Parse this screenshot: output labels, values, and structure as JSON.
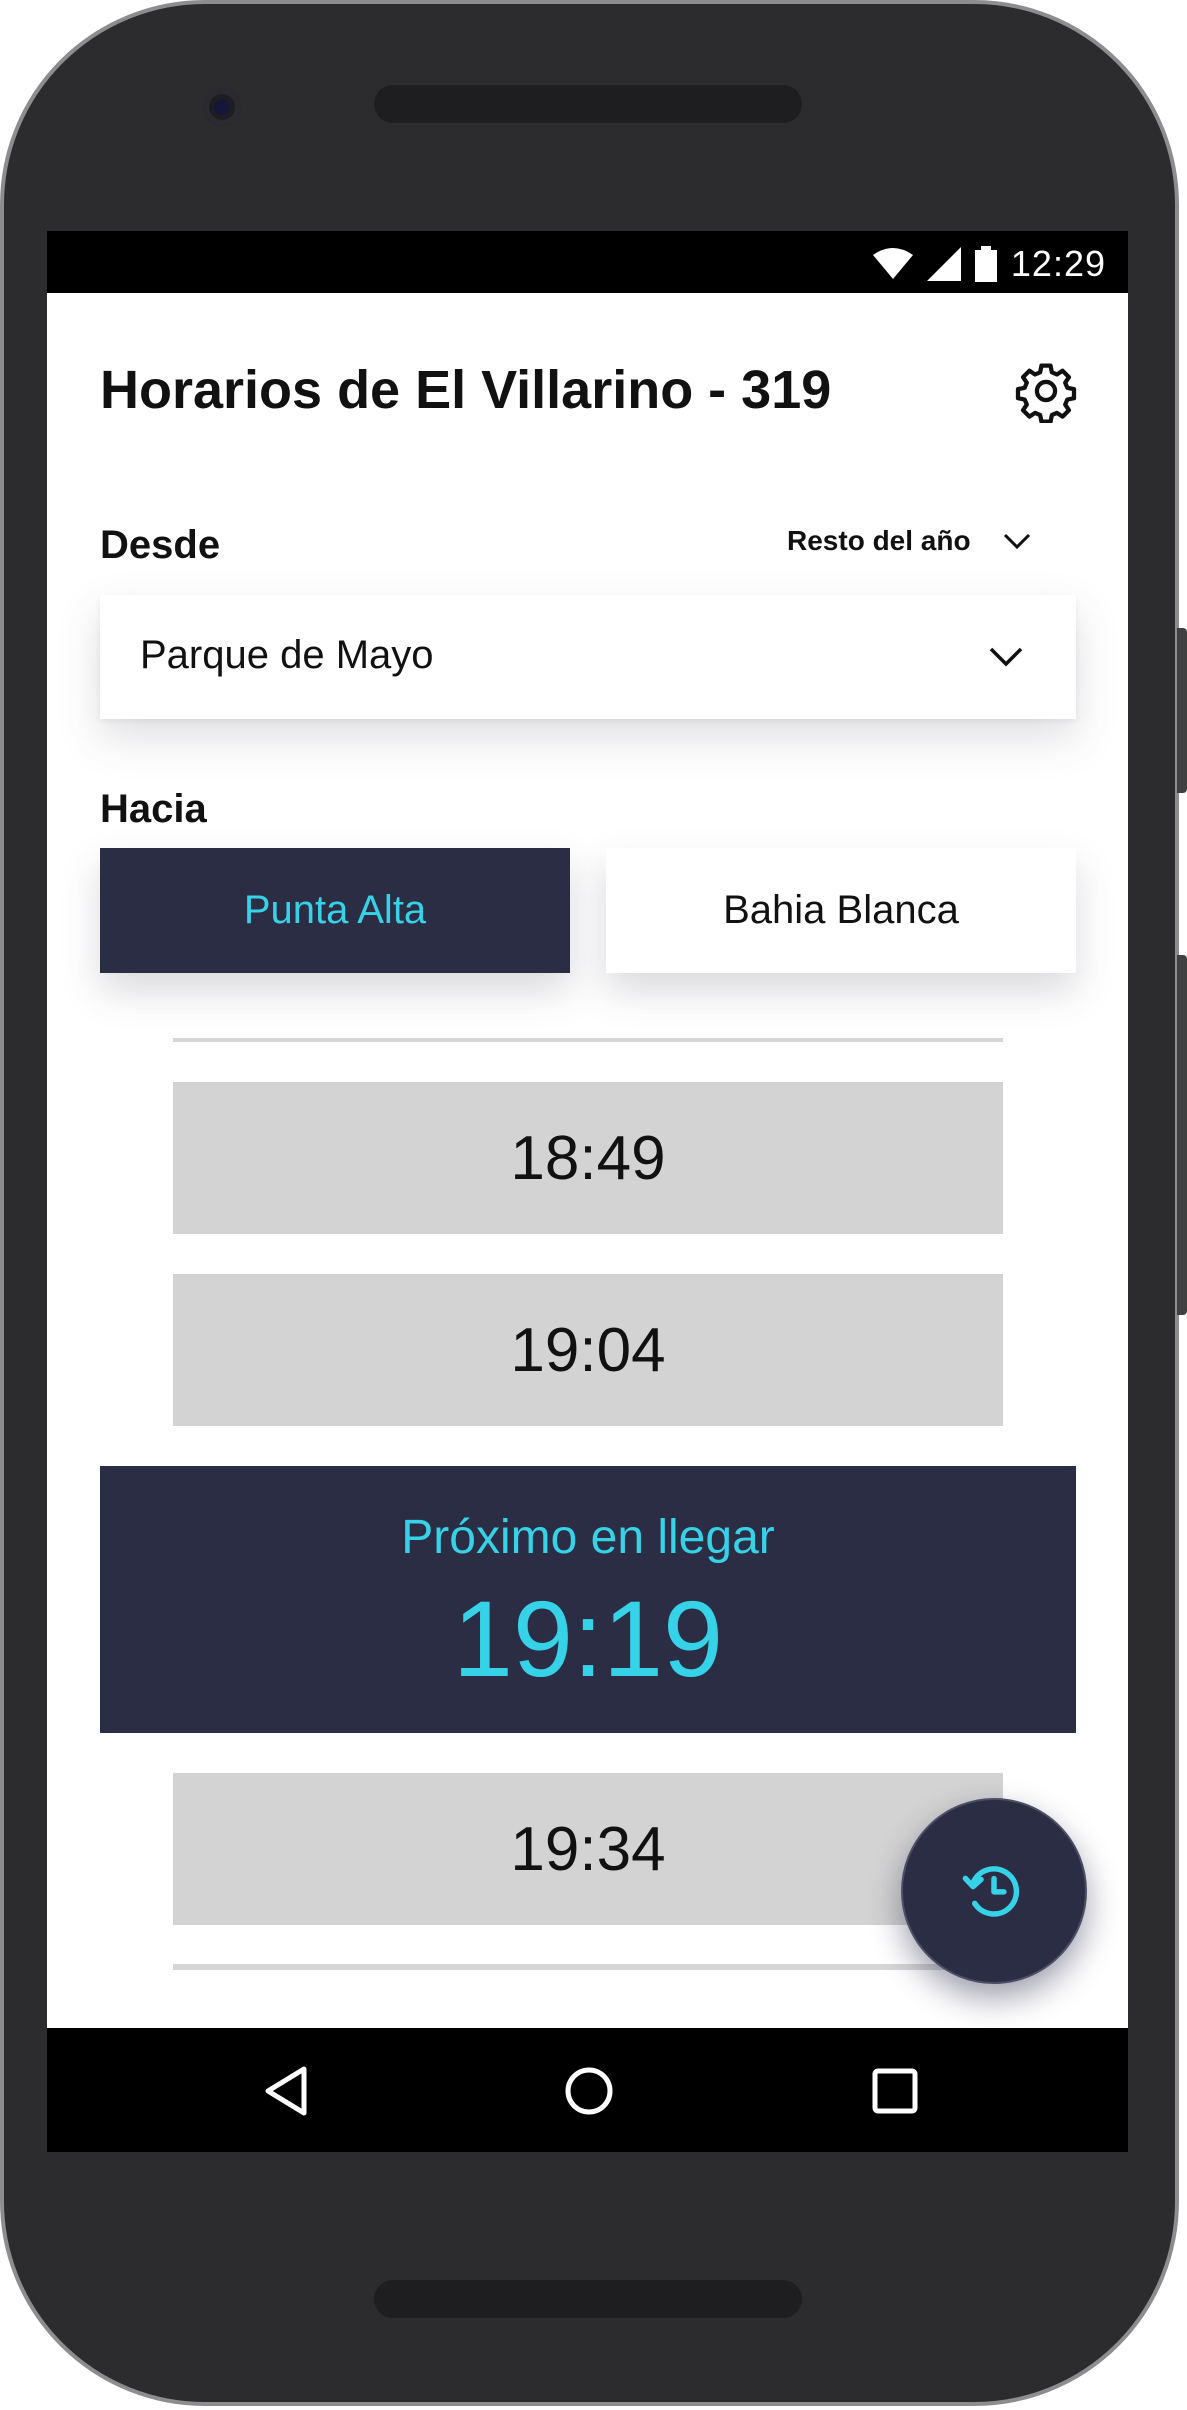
{
  "status_bar": {
    "time": "12:29",
    "icons": [
      "wifi-icon",
      "signal-icon",
      "battery-icon"
    ]
  },
  "header": {
    "title": "Horarios de El Villarino - 319",
    "settings_icon": "gear-icon"
  },
  "from": {
    "label": "Desde",
    "season": "Resto del año",
    "selected_stop": "Parque de Mayo"
  },
  "to": {
    "label": "Hacia",
    "options": [
      {
        "label": "Punta Alta",
        "selected": true
      },
      {
        "label": "Bahia Blanca",
        "selected": false
      }
    ]
  },
  "schedule": {
    "before": [
      "18:49",
      "19:04"
    ],
    "next": {
      "label": "Próximo en llegar",
      "time": "19:19"
    },
    "after": [
      "19:34"
    ]
  },
  "fab": {
    "icon": "history-icon"
  },
  "nav": {
    "icons": [
      "back-icon",
      "home-icon",
      "recents-icon"
    ]
  },
  "colors": {
    "accent": "#36d2e8",
    "primary_dark": "#2b2d45",
    "row_bg": "#d3d3d3"
  }
}
